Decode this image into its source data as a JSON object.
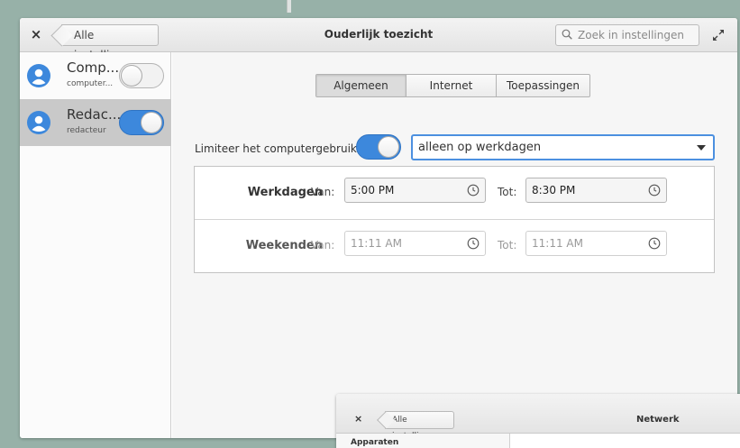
{
  "header": {
    "close_label": "×",
    "back_label": "Alle instellingen",
    "title": "Ouderlijk toezicht",
    "search_placeholder": "Zoek in instellingen"
  },
  "sidebar": {
    "users": [
      {
        "name": "Comp...",
        "account": "computer...",
        "enabled": false,
        "selected": false
      },
      {
        "name": "Redac...",
        "account": "redacteur",
        "enabled": true,
        "selected": true
      }
    ]
  },
  "tabs": [
    {
      "label": "Algemeen",
      "active": true
    },
    {
      "label": "Internet",
      "active": false
    },
    {
      "label": "Toepassingen",
      "active": false
    }
  ],
  "limit": {
    "label": "Limiteer het computergebruik:",
    "enabled": true,
    "selected_option": "alleen op werkdagen"
  },
  "schedule": {
    "weekdays": {
      "label": "Werkdagen",
      "from_label": "Van:",
      "from": "5:00 PM",
      "to_label": "Tot:",
      "to": "8:30 PM",
      "enabled": true
    },
    "weekends": {
      "label": "Weekenden",
      "from_label": "Van:",
      "from": "11:11 AM",
      "to_label": "Tot:",
      "to": "11:11 AM",
      "enabled": false
    }
  },
  "second_window": {
    "close_label": "×",
    "back_label": "Alle instellingen",
    "title": "Netwerk",
    "section_label": "Apparaten"
  },
  "colors": {
    "accent": "#3d88dc",
    "desktop": "#97b1a8"
  }
}
